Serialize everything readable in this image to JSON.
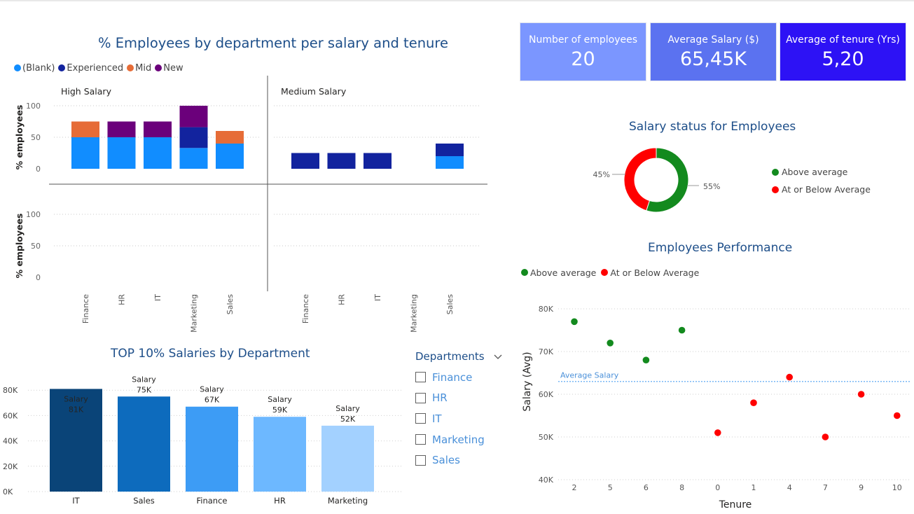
{
  "palette": {
    "blank": "#118dff",
    "experienced": "#12239e",
    "mid": "#e66c37",
    "new": "#6b007b",
    "above": "#138a1e",
    "below": "#ff0000",
    "title": "#1d4e89"
  },
  "kpi_cards": [
    {
      "label": "Number of employees",
      "value": "20",
      "color": "#7b96ff"
    },
    {
      "label": "Average Salary ($)",
      "value": "65,45K",
      "color": "#5b72f0"
    },
    {
      "label": "Average of tenure (Yrs)",
      "value": "5,20",
      "color": "#2d12f5"
    }
  ],
  "slicer": {
    "title": "Departments",
    "items": [
      "Finance",
      "HR",
      "IT",
      "Marketing",
      "Sales"
    ]
  },
  "chart_data": [
    {
      "type": "bar",
      "stacked": true,
      "title": "% Employees by department per salary and tenure",
      "legend": [
        "(Blank)",
        "Experienced",
        "Mid",
        "New"
      ],
      "legend_position": "top-left",
      "ylabel": "% employees",
      "yticks": [
        0,
        50,
        100
      ],
      "ylim": [
        0,
        100
      ],
      "grid": true,
      "categories": [
        "Finance",
        "HR",
        "IT",
        "Marketing",
        "Sales"
      ],
      "panels": [
        {
          "label": "High Salary",
          "series": [
            {
              "name": "(Blank)",
              "values": [
                50,
                50,
                50,
                33,
                40
              ]
            },
            {
              "name": "Experienced",
              "values": [
                0,
                0,
                0,
                33,
                0
              ]
            },
            {
              "name": "Mid",
              "values": [
                25,
                0,
                0,
                0,
                20
              ]
            },
            {
              "name": "New",
              "values": [
                0,
                25,
                25,
                34,
                0
              ]
            }
          ]
        },
        {
          "label": "Medium Salary",
          "series": [
            {
              "name": "(Blank)",
              "values": [
                0,
                0,
                0,
                0,
                20
              ]
            },
            {
              "name": "Experienced",
              "values": [
                25,
                25,
                25,
                0,
                20
              ]
            },
            {
              "name": "Mid",
              "values": [
                0,
                0,
                0,
                0,
                0
              ]
            },
            {
              "name": "New",
              "values": [
                0,
                0,
                0,
                0,
                0
              ]
            }
          ]
        },
        {
          "label": "",
          "series": []
        },
        {
          "label": "",
          "series": []
        }
      ]
    },
    {
      "type": "bar",
      "title": "TOP 10% Salaries by Department",
      "categories": [
        "IT",
        "Sales",
        "Finance",
        "HR",
        "Marketing"
      ],
      "values": [
        81,
        75,
        67,
        59,
        52
      ],
      "value_labels": [
        "81K",
        "75K",
        "67K",
        "59K",
        "52K"
      ],
      "label_title": "Salary",
      "colors": [
        "#0a4478",
        "#0d6bbd",
        "#3d9cf5",
        "#6db8ff",
        "#a3d1ff"
      ],
      "yticks": [
        "0K",
        "20K",
        "40K",
        "60K",
        "80K"
      ],
      "ylim": [
        0,
        90
      ],
      "grid": true
    },
    {
      "type": "pie",
      "donut": true,
      "title": "Salary status for Employees",
      "slices": [
        {
          "label": "Above average",
          "value": 55,
          "pct": "55%"
        },
        {
          "label": "At or Below Average",
          "value": 45,
          "pct": "45%"
        }
      ],
      "legend_position": "right"
    },
    {
      "type": "scatter",
      "title": "Employees Performance",
      "legend": [
        "Above average",
        "At or Below Average"
      ],
      "legend_position": "top-left",
      "xlabel": "Tenure",
      "ylabel": "Salary (Avg)",
      "x_categories": [
        "2",
        "5",
        "6",
        "8",
        "0",
        "1",
        "4",
        "7",
        "9",
        "10"
      ],
      "yticks": [
        "40K",
        "50K",
        "60K",
        "70K",
        "80K"
      ],
      "ylim": [
        40,
        80
      ],
      "reference_line": {
        "label": "Average Salary",
        "value": 63
      },
      "series": [
        {
          "name": "Above average",
          "points": [
            [
              2,
              77
            ],
            [
              5,
              72
            ],
            [
              6,
              68
            ],
            [
              8,
              75
            ]
          ]
        },
        {
          "name": "At or Below Average",
          "points": [
            [
              0,
              51
            ],
            [
              1,
              58
            ],
            [
              4,
              64
            ],
            [
              7,
              50
            ],
            [
              9,
              60
            ],
            [
              10,
              55
            ]
          ]
        }
      ]
    }
  ]
}
